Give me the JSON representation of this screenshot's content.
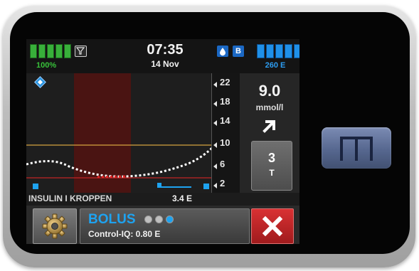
{
  "status_bar": {
    "battery_percent": "100%",
    "time": "07:35",
    "date": "14 Nov",
    "mode_badge": "B",
    "insulin_remaining": "260 E"
  },
  "graph": {
    "axis_labels": [
      "22",
      "18",
      "14",
      "10",
      "6",
      "2"
    ],
    "high_target": 10.0,
    "low_target": 3.9,
    "trace_color": "#ffffff",
    "low_trace_color": "#e02424"
  },
  "glucose": {
    "value": "9.0",
    "unit": "mmol/l",
    "trend_icon": "arrow-up-right-icon"
  },
  "t_button": {
    "number": "3",
    "letter": "T"
  },
  "iob": {
    "label": "INSULIN I KROPPEN",
    "value": "3.4 E"
  },
  "bolus": {
    "label": "BOLUS",
    "subtext": "Control-IQ: 0.80 E",
    "dots": [
      "#bfbfbf",
      "#bfbfbf",
      "#1ea3f0"
    ]
  },
  "icons": {
    "settings": "gear-icon",
    "close": "close-icon",
    "filter": "filter-icon",
    "drop": "drop-icon",
    "diamond": "diamond-icon"
  },
  "colors": {
    "battery": "#38b03a",
    "insulin": "#1f90e8",
    "accent": "#1ea3f0",
    "close": "#d93133"
  }
}
